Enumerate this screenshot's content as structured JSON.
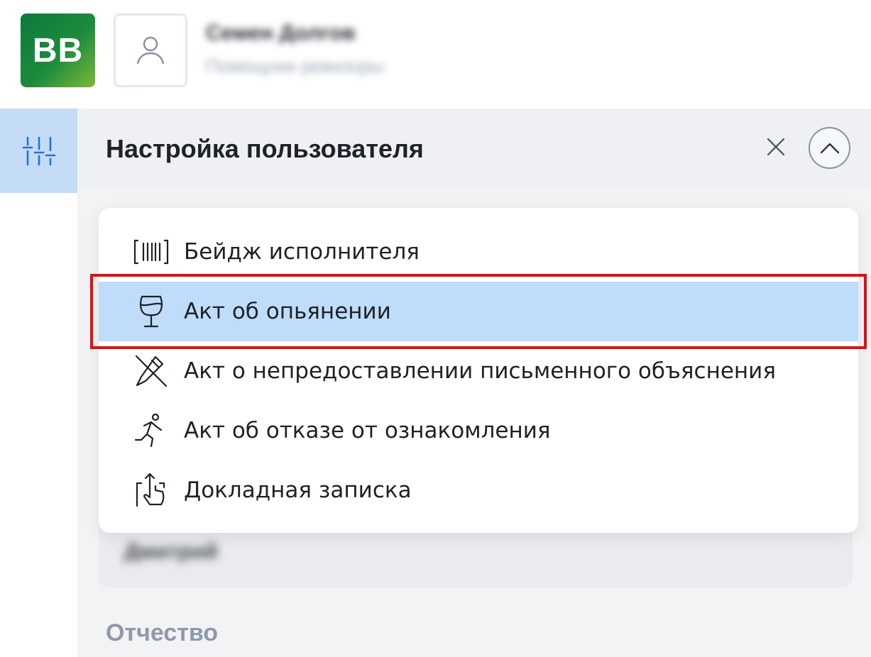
{
  "header": {
    "logo_text": "BB",
    "user_name": "Семен Долгов",
    "user_role": "Помощник ревизоры"
  },
  "panel": {
    "title": "Настройка пользователя",
    "blurred_value": "Дмитрий",
    "patronymic_label": "Отчество"
  },
  "menu": {
    "items": [
      {
        "label": "Бейдж исполнителя",
        "icon": "badge-barcode-icon"
      },
      {
        "label": "Акт об опьянении",
        "icon": "wine-glass-icon",
        "selected": true
      },
      {
        "label": "Акт о непредоставлении письменного объяснения",
        "icon": "no-pen-icon"
      },
      {
        "label": "Акт об отказе от ознакомления",
        "icon": "running-person-icon"
      },
      {
        "label": "Докладная записка",
        "icon": "hand-upload-icon"
      }
    ]
  },
  "colors": {
    "accent": "#c4dcf6",
    "selected_item": "#bfdcfb",
    "highlight_border": "#e01010",
    "logo_green": "#0c7a3f"
  }
}
